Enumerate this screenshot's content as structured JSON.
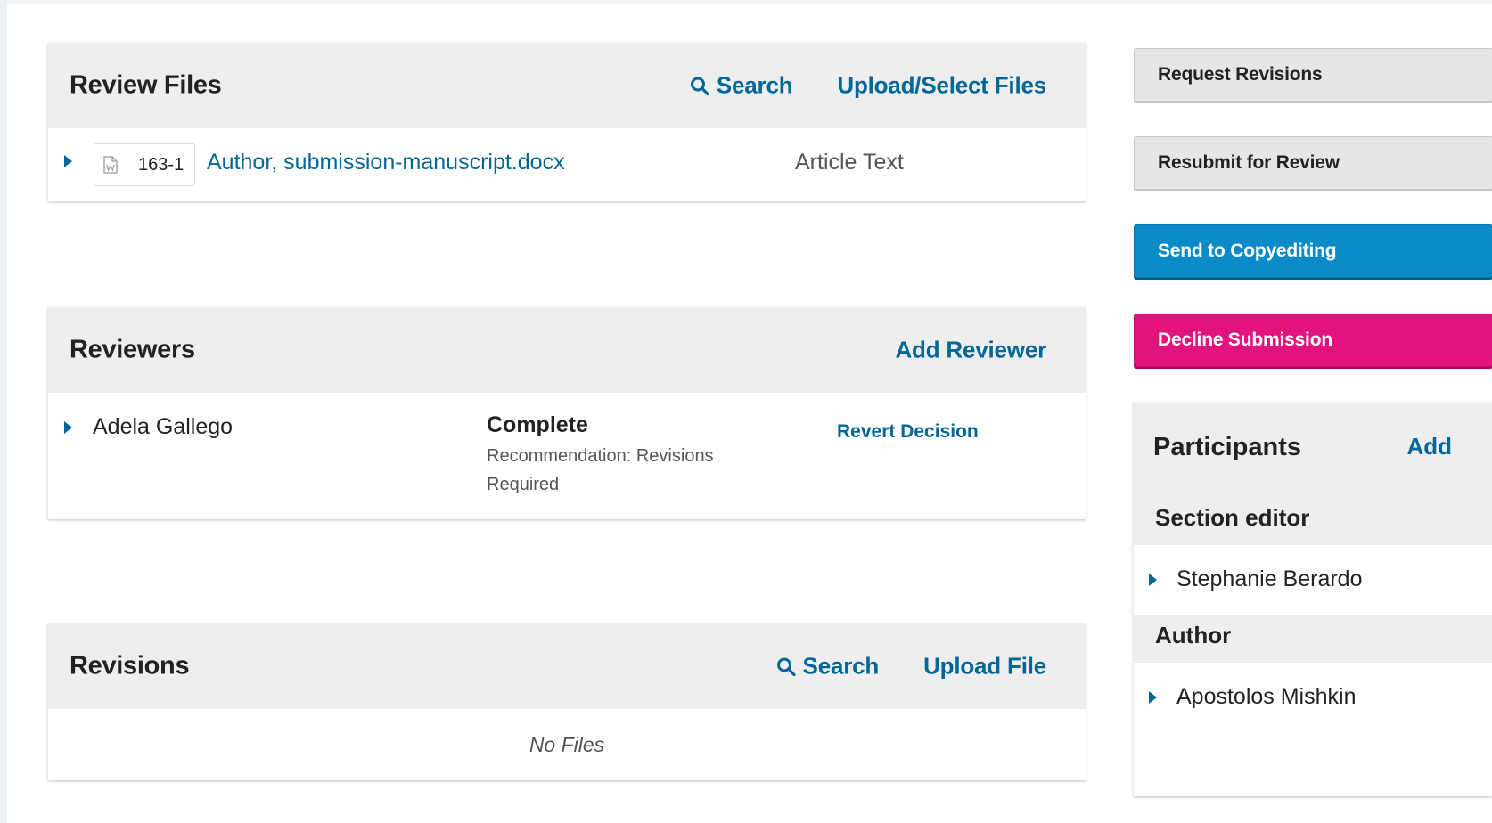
{
  "review_files": {
    "title": "Review Files",
    "search_label": "Search",
    "upload_label": "Upload/Select Files",
    "files": [
      {
        "id": "163-1",
        "name": "Author, submission-manuscript.docx",
        "type": "Article Text"
      }
    ]
  },
  "reviewers": {
    "title": "Reviewers",
    "add_label": "Add Reviewer",
    "rows": [
      {
        "name": "Adela Gallego",
        "status": "Complete",
        "recommendation_line1": "Recommendation: Revisions",
        "recommendation_line2": "Required",
        "action": "Revert Decision"
      }
    ]
  },
  "revisions": {
    "title": "Revisions",
    "search_label": "Search",
    "upload_label": "Upload File",
    "empty_text": "No Files"
  },
  "actions": {
    "request_revisions": "Request Revisions",
    "resubmit": "Resubmit for Review",
    "send_copyediting": "Send to Copyediting",
    "decline": "Decline Submission"
  },
  "participants": {
    "title": "Participants",
    "add_label": "Add",
    "groups": [
      {
        "role": "Section editor",
        "members": [
          "Stephanie Berardo"
        ]
      },
      {
        "role": "Author",
        "members": [
          "Apostolos Mishkin"
        ]
      }
    ]
  },
  "colors": {
    "link": "#006798",
    "primary": "#0b8ac8",
    "danger": "#e3137e",
    "header_bg": "#eeeeee"
  }
}
